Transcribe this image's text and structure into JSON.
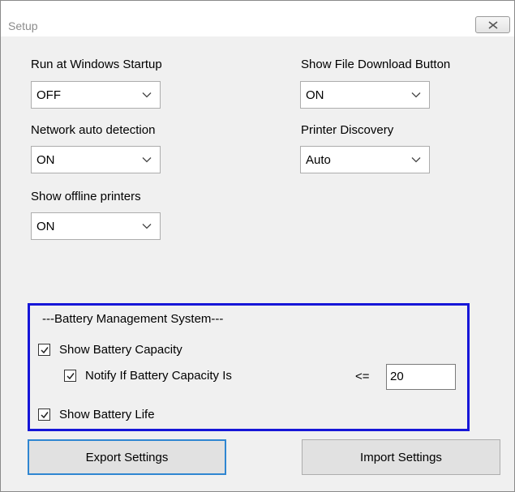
{
  "window": {
    "title": "Setup"
  },
  "settings": {
    "run_at_startup": {
      "label": "Run at Windows Startup",
      "value": "OFF"
    },
    "show_file_download": {
      "label": "Show File Download Button",
      "value": "ON"
    },
    "network_auto_detection": {
      "label": "Network auto detection",
      "value": "ON"
    },
    "printer_discovery": {
      "label": "Printer Discovery",
      "value": "Auto"
    },
    "show_offline_printers": {
      "label": "Show offline printers",
      "value": "ON"
    }
  },
  "battery": {
    "heading": "---Battery Management System---",
    "show_capacity": {
      "label": "Show Battery Capacity",
      "checked": true
    },
    "notify_capacity": {
      "label": "Notify If Battery Capacity Is",
      "checked": true
    },
    "operator": "<=",
    "threshold": "20",
    "show_life": {
      "label": "Show Battery Life",
      "checked": true
    }
  },
  "buttons": {
    "export": "Export Settings",
    "import": "Import Settings"
  },
  "colors": {
    "highlight_box": "#1616d8",
    "default_button_border": "#2f86d1"
  }
}
